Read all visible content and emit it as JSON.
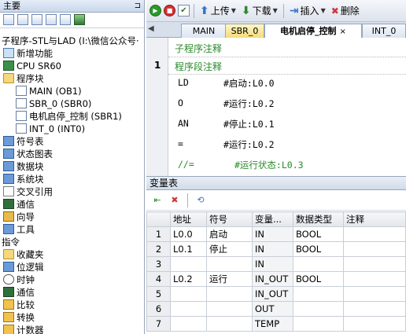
{
  "left_panel": {
    "title": "主要",
    "pin": "⊐",
    "project_path": "子程序-STL与LAD (I:\\微信公众号·",
    "tree": [
      {
        "label": "新增功能",
        "icon": "star-icon",
        "level": 0
      },
      {
        "label": "CPU SR60",
        "icon": "cpu-icon",
        "level": 0
      },
      {
        "label": "程序块",
        "icon": "folder-icon",
        "level": 0,
        "expanded": true
      },
      {
        "label": "MAIN (OB1)",
        "icon": "document-icon",
        "level": 1
      },
      {
        "label": "SBR_0 (SBR0)",
        "icon": "document-icon",
        "level": 1
      },
      {
        "label": "电机启停_控制 (SBR1)",
        "icon": "document-icon",
        "level": 1
      },
      {
        "label": "INT_0 (INT0)",
        "icon": "document-icon",
        "level": 1
      },
      {
        "label": "符号表",
        "icon": "table-icon",
        "level": 0
      },
      {
        "label": "状态图表",
        "icon": "chart-icon",
        "level": 0
      },
      {
        "label": "数据块",
        "icon": "datablock-icon",
        "level": 0
      },
      {
        "label": "系统块",
        "icon": "systemblock-icon",
        "level": 0
      },
      {
        "label": "交叉引用",
        "icon": "crossref-icon",
        "level": 0
      },
      {
        "label": "通信",
        "icon": "comm-icon",
        "level": 0
      },
      {
        "label": "向导",
        "icon": "wizard-icon",
        "level": 0
      },
      {
        "label": "工具",
        "icon": "tool-icon",
        "level": 0
      },
      {
        "label": "指令",
        "icon": "",
        "level": -1
      },
      {
        "label": "收藏夹",
        "icon": "favorites-icon",
        "level": 0
      },
      {
        "label": "位逻辑",
        "icon": "bitlogic-icon",
        "level": 0
      },
      {
        "label": "时钟",
        "icon": "clock-icon",
        "level": 0
      },
      {
        "label": "通信",
        "icon": "comm-icon",
        "level": 0
      },
      {
        "label": "比较",
        "icon": "compare-icon",
        "level": 0
      },
      {
        "label": "转换",
        "icon": "convert-icon",
        "level": 0
      },
      {
        "label": "计数器",
        "icon": "counter-icon",
        "level": 0
      }
    ]
  },
  "toolbar": {
    "upload_label": "上传",
    "download_label": "下载",
    "insert_label": "插入",
    "delete_label": "删除"
  },
  "tabs": [
    {
      "label": "MAIN"
    },
    {
      "label": "SBR_0"
    },
    {
      "label": "电机启停_控制",
      "close": "×"
    },
    {
      "label": "INT_0"
    }
  ],
  "code": {
    "subroutine_comment": "子程序注释",
    "network_number": "1",
    "network_comment": "程序段注释",
    "lines": [
      {
        "op": "LD",
        "operand": "#启动:L0.0"
      },
      {
        "op": "O",
        "operand": "#运行:L0.2"
      },
      {
        "op": "AN",
        "operand": "#停止:L0.1"
      },
      {
        "op": "=",
        "operand": "#运行:L0.2"
      },
      {
        "op": "//=",
        "operand": "#运行状态:L0.3"
      }
    ]
  },
  "var_table": {
    "title": "变量表",
    "headers": [
      "地址",
      "符号",
      "变量...",
      "数据类型",
      "注释"
    ],
    "rows": [
      {
        "num": "1",
        "addr": "L0.0",
        "symbol": "启动",
        "vartype": "IN",
        "datatype": "BOOL",
        "comment": ""
      },
      {
        "num": "2",
        "addr": "L0.1",
        "symbol": "停止",
        "vartype": "IN",
        "datatype": "BOOL",
        "comment": ""
      },
      {
        "num": "3",
        "addr": "",
        "symbol": "",
        "vartype": "IN",
        "datatype": "",
        "comment": ""
      },
      {
        "num": "4",
        "addr": "L0.2",
        "symbol": "运行",
        "vartype": "IN_OUT",
        "datatype": "BOOL",
        "comment": ""
      },
      {
        "num": "5",
        "addr": "",
        "symbol": "",
        "vartype": "IN_OUT",
        "datatype": "",
        "comment": ""
      },
      {
        "num": "6",
        "addr": "",
        "symbol": "",
        "vartype": "OUT",
        "datatype": "",
        "comment": ""
      },
      {
        "num": "7",
        "addr": "",
        "symbol": "",
        "vartype": "TEMP",
        "datatype": "",
        "comment": ""
      }
    ]
  }
}
